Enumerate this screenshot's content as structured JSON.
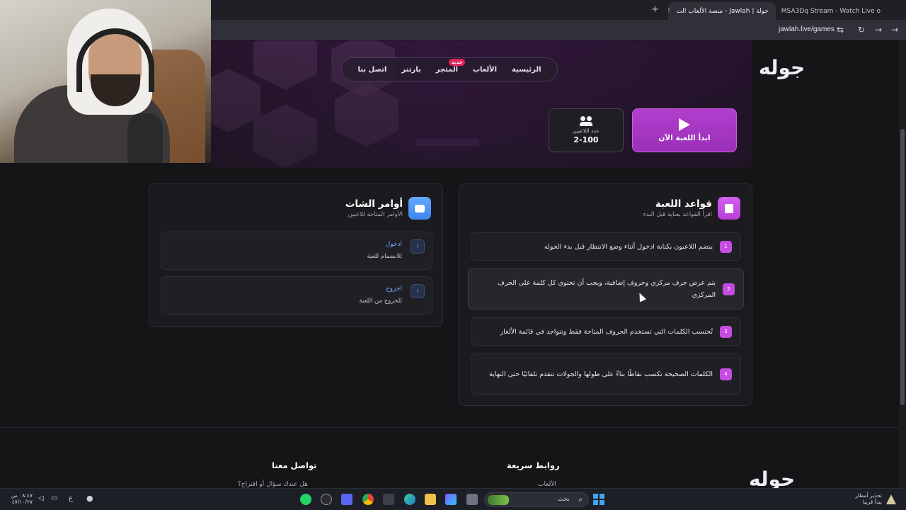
{
  "browser": {
    "tabs": [
      {
        "label": "جولة | Jawlah - منصة الألعاب الت",
        "active": true
      },
      {
        "label": "MSA3Dq Stream - Watch Live o",
        "active": false
      }
    ],
    "url": "jawlah.live/games"
  },
  "site": {
    "logo": "جوله",
    "nav": [
      "الرئيسية",
      "الألعاب",
      "المتجر",
      "بارتنر",
      "اتصل بنا"
    ],
    "store_badge": "جديد"
  },
  "hero": {
    "play_label": "ابدأ اللعبة الآن",
    "players_label": "عدد اللاعبين",
    "players_value": "2-100"
  },
  "rules": {
    "title": "قواعد اللعبة",
    "subtitle": "اقرأ القواعد بعناية قبل البدء",
    "items": [
      {
        "num": "1",
        "text": "ينضم اللاعبون بكتابة ادخول أثناء وضع الانتظار قبل بدء الجوله"
      },
      {
        "num": "2",
        "text": "يتم عرض حرف مركزي وحروف إضافية، ويجب أن تحتوي كل كلمة على الحرف المركزي"
      },
      {
        "num": "3",
        "text": "تُحتسب الكلمات التي تستخدم الحروف المتاحة فقط وتتواجد في قائمة الألغاز"
      },
      {
        "num": "4",
        "text": "الكلمات الصحيحة تكسب نقاطًا بناءً على طولها والجولات تتقدم تلقائيًا حتى النهاية"
      }
    ]
  },
  "chat": {
    "title": "أوامر الشات",
    "subtitle": "الأوامر المتاحة للاعبين",
    "commands": [
      {
        "tag": "!",
        "name": "ادخول",
        "desc": "للانضمام للعبة"
      },
      {
        "tag": "!",
        "name": "اخروج",
        "desc": "للخروج من اللعبة"
      }
    ]
  },
  "footer": {
    "contact_title": "تواصل معنا",
    "contact_line": "هل عندك سؤال أو اقتراح؟",
    "links_title": "روابط سريعة",
    "links_first": "الألعاب",
    "logo": "جوله"
  },
  "taskbar": {
    "search_label": "بحث",
    "lang": "ع",
    "time": "٠٨:٤٧ ص",
    "date": "٤٧/١٠/٢٧",
    "weather_title": "تحذير أمطار",
    "weather_sub": "يبدأ قريبا"
  },
  "colors": {
    "accent": "#b73fd6",
    "blue": "#3f85ee",
    "bg": "#151518"
  }
}
